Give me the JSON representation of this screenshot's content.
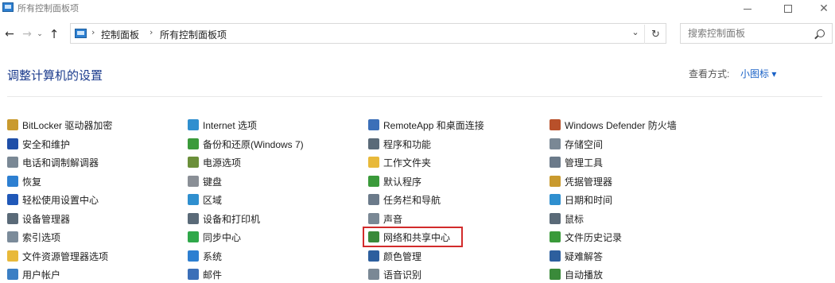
{
  "window": {
    "title": "所有控制面板项",
    "minimize_glyph": "—",
    "maximize_glyph": "☐",
    "close_glyph": "✕"
  },
  "nav": {
    "back_glyph": "←",
    "forward_glyph": "→",
    "recent_glyph": "⌄",
    "up_glyph": "↑"
  },
  "address": {
    "crumbs": [
      "控制面板",
      "所有控制面板项"
    ],
    "separator": "›",
    "dropdown_glyph": "⌄",
    "refresh_glyph": "↻"
  },
  "search": {
    "placeholder": "搜索控制面板"
  },
  "header": {
    "title": "调整计算机的设置",
    "view_by_label": "查看方式:",
    "view_by_value": "小图标 ▾"
  },
  "columns": [
    [
      {
        "label": "BitLocker 驱动器加密",
        "icon": "bitlocker-icon",
        "color": "#c99a2e"
      },
      {
        "label": "安全和维护",
        "icon": "flag-icon",
        "color": "#1f4fa8"
      },
      {
        "label": "电话和调制解调器",
        "icon": "phone-modem-icon",
        "color": "#7a8895"
      },
      {
        "label": "恢复",
        "icon": "recovery-icon",
        "color": "#2d7fd1"
      },
      {
        "label": "轻松使用设置中心",
        "icon": "ease-of-access-icon",
        "color": "#2058b8"
      },
      {
        "label": "设备管理器",
        "icon": "device-manager-icon",
        "color": "#5a6a78"
      },
      {
        "label": "索引选项",
        "icon": "indexing-icon",
        "color": "#7b8b9a"
      },
      {
        "label": "文件资源管理器选项",
        "icon": "folder-options-icon",
        "color": "#e8b93a"
      },
      {
        "label": "用户帐户",
        "icon": "user-accounts-icon",
        "color": "#3b7fc4"
      }
    ],
    [
      {
        "label": "Internet 选项",
        "icon": "internet-options-icon",
        "color": "#2f8fcf"
      },
      {
        "label": "备份和还原(Windows 7)",
        "icon": "backup-restore-icon",
        "color": "#3a9a3a"
      },
      {
        "label": "电源选项",
        "icon": "power-options-icon",
        "color": "#6b8f3a"
      },
      {
        "label": "键盘",
        "icon": "keyboard-icon",
        "color": "#8a8f96"
      },
      {
        "label": "区域",
        "icon": "region-icon",
        "color": "#2f8fcf"
      },
      {
        "label": "设备和打印机",
        "icon": "devices-printers-icon",
        "color": "#5a6a78"
      },
      {
        "label": "同步中心",
        "icon": "sync-center-icon",
        "color": "#2fa84a"
      },
      {
        "label": "系统",
        "icon": "system-icon",
        "color": "#2d7fd1"
      },
      {
        "label": "邮件",
        "icon": "mail-icon",
        "color": "#3b6fb8"
      }
    ],
    [
      {
        "label": "RemoteApp 和桌面连接",
        "icon": "remoteapp-icon",
        "color": "#3b6fb8"
      },
      {
        "label": "程序和功能",
        "icon": "programs-features-icon",
        "color": "#5a6a78"
      },
      {
        "label": "工作文件夹",
        "icon": "work-folders-icon",
        "color": "#e8b93a"
      },
      {
        "label": "默认程序",
        "icon": "default-programs-icon",
        "color": "#3a9a3a"
      },
      {
        "label": "任务栏和导航",
        "icon": "taskbar-navigation-icon",
        "color": "#6b7a8a"
      },
      {
        "label": "声音",
        "icon": "sound-icon",
        "color": "#7a8895"
      },
      {
        "label": "网络和共享中心",
        "icon": "network-sharing-icon",
        "color": "#3a8a3a"
      },
      {
        "label": "颜色管理",
        "icon": "color-management-icon",
        "color": "#2d5f9e"
      },
      {
        "label": "语音识别",
        "icon": "speech-recognition-icon",
        "color": "#7a8895"
      }
    ],
    [
      {
        "label": "Windows Defender 防火墙",
        "icon": "firewall-icon",
        "color": "#b8502a"
      },
      {
        "label": "存储空间",
        "icon": "storage-spaces-icon",
        "color": "#7a8895"
      },
      {
        "label": "管理工具",
        "icon": "admin-tools-icon",
        "color": "#6b7a8a"
      },
      {
        "label": "凭据管理器",
        "icon": "credential-manager-icon",
        "color": "#c99a2e"
      },
      {
        "label": "日期和时间",
        "icon": "date-time-icon",
        "color": "#2f8fcf"
      },
      {
        "label": "鼠标",
        "icon": "mouse-icon",
        "color": "#5a6a78"
      },
      {
        "label": "文件历史记录",
        "icon": "file-history-icon",
        "color": "#3a9a3a"
      },
      {
        "label": "疑难解答",
        "icon": "troubleshooting-icon",
        "color": "#2d5f9e"
      },
      {
        "label": "自动播放",
        "icon": "autoplay-icon",
        "color": "#3a8a3a"
      }
    ]
  ],
  "highlighted_item": "网络和共享中心"
}
